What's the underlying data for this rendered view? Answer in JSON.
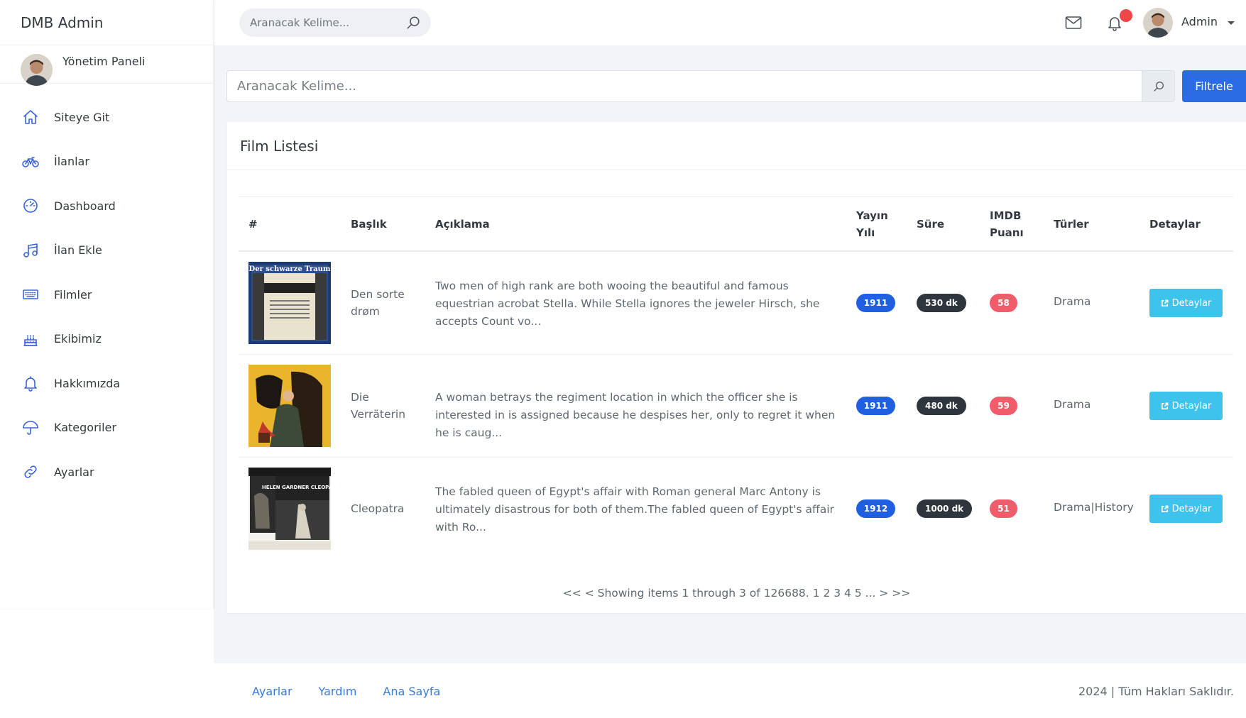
{
  "sidebar": {
    "brand": "DMB Admin",
    "profile_name": "Yönetim Paneli",
    "items": [
      {
        "label": "Siteye Git",
        "icon": "home-icon"
      },
      {
        "label": "İlanlar",
        "icon": "bicycle-icon"
      },
      {
        "label": "Dashboard",
        "icon": "gauge-icon"
      },
      {
        "label": "İlan Ekle",
        "icon": "music-note-icon"
      },
      {
        "label": "Filmler",
        "icon": "keyboard-icon"
      },
      {
        "label": "Ekibimiz",
        "icon": "cake-icon"
      },
      {
        "label": "Hakkımızda",
        "icon": "bell-icon"
      },
      {
        "label": "Kategoriler",
        "icon": "umbrella-icon"
      },
      {
        "label": "Ayarlar",
        "icon": "link-icon"
      }
    ]
  },
  "topbar": {
    "search_placeholder": "Aranacak Kelime...",
    "user_name": "Admin",
    "notification_dot_color": "#ef4747"
  },
  "filter": {
    "placeholder": "Aranacak Kelime...",
    "button_label": "Filtrele"
  },
  "card": {
    "title": "Film Listesi",
    "columns": [
      "#",
      "Başlık",
      "Açıklama",
      "Yayın Yılı",
      "Süre",
      "IMDB Puanı",
      "Türler",
      "Detaylar"
    ],
    "rows": [
      {
        "title": "Den sorte drøm",
        "description": "Two men of high rank are both wooing the beautiful and famous equestrian acrobat Stella. While Stella ignores the jeweler Hirsch, she accepts Count vo...",
        "year": "1911",
        "duration": "530 dk",
        "imdb": "58",
        "genres": "Drama",
        "details_label": "Detaylar",
        "poster_text": "Der schwarze Traum"
      },
      {
        "title": "Die Verräterin",
        "description": "A woman betrays the regiment location in which the officer she is interested in is assigned because he despises her, only to regret it when he is caug...",
        "year": "1911",
        "duration": "480 dk",
        "imdb": "59",
        "genres": "Drama",
        "details_label": "Detaylar",
        "poster_text": ""
      },
      {
        "title": "Cleopatra",
        "description": "The fabled queen of Egypt's affair with Roman general Marc Antony is ultimately disastrous for both of them.The fabled queen of Egypt's affair with Ro...",
        "year": "1912",
        "duration": "1000 dk",
        "imdb": "51",
        "genres": "Drama|History",
        "details_label": "Detaylar",
        "poster_text": "HELEN GARDNER CLEOPATRA"
      }
    ],
    "pagination": "<< < Showing items 1 through 3 of 126688. 1 2 3 4 5 ... > >>"
  },
  "footer": {
    "links": [
      "Ayarlar",
      "Yardım",
      "Ana Sayfa"
    ],
    "copyright": "2024 | Tüm Hakları Saklıdır."
  },
  "colors": {
    "accent": "#2b6be3",
    "year_badge": "#1f5fe0",
    "duration_badge": "#2e353c",
    "imdb_badge": "#f05c6a",
    "details_button": "#3ec3ed",
    "nav_icon": "#3a63d8"
  }
}
